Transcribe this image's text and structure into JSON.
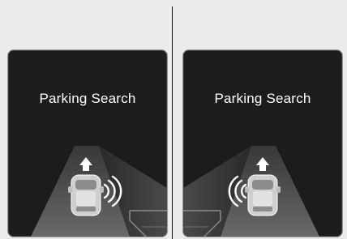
{
  "panels": [
    {
      "title": "Parking Search",
      "sensor_side": "right"
    },
    {
      "title": "Parking Search",
      "sensor_side": "left"
    }
  ],
  "colors": {
    "background": "#ebebeb",
    "panel": "#1d1b1c",
    "text": "#ffffff",
    "car": "#cfcfcf"
  },
  "icons": [
    "parking-sensor-waves-icon",
    "forward-arrow-icon",
    "car-icon"
  ]
}
